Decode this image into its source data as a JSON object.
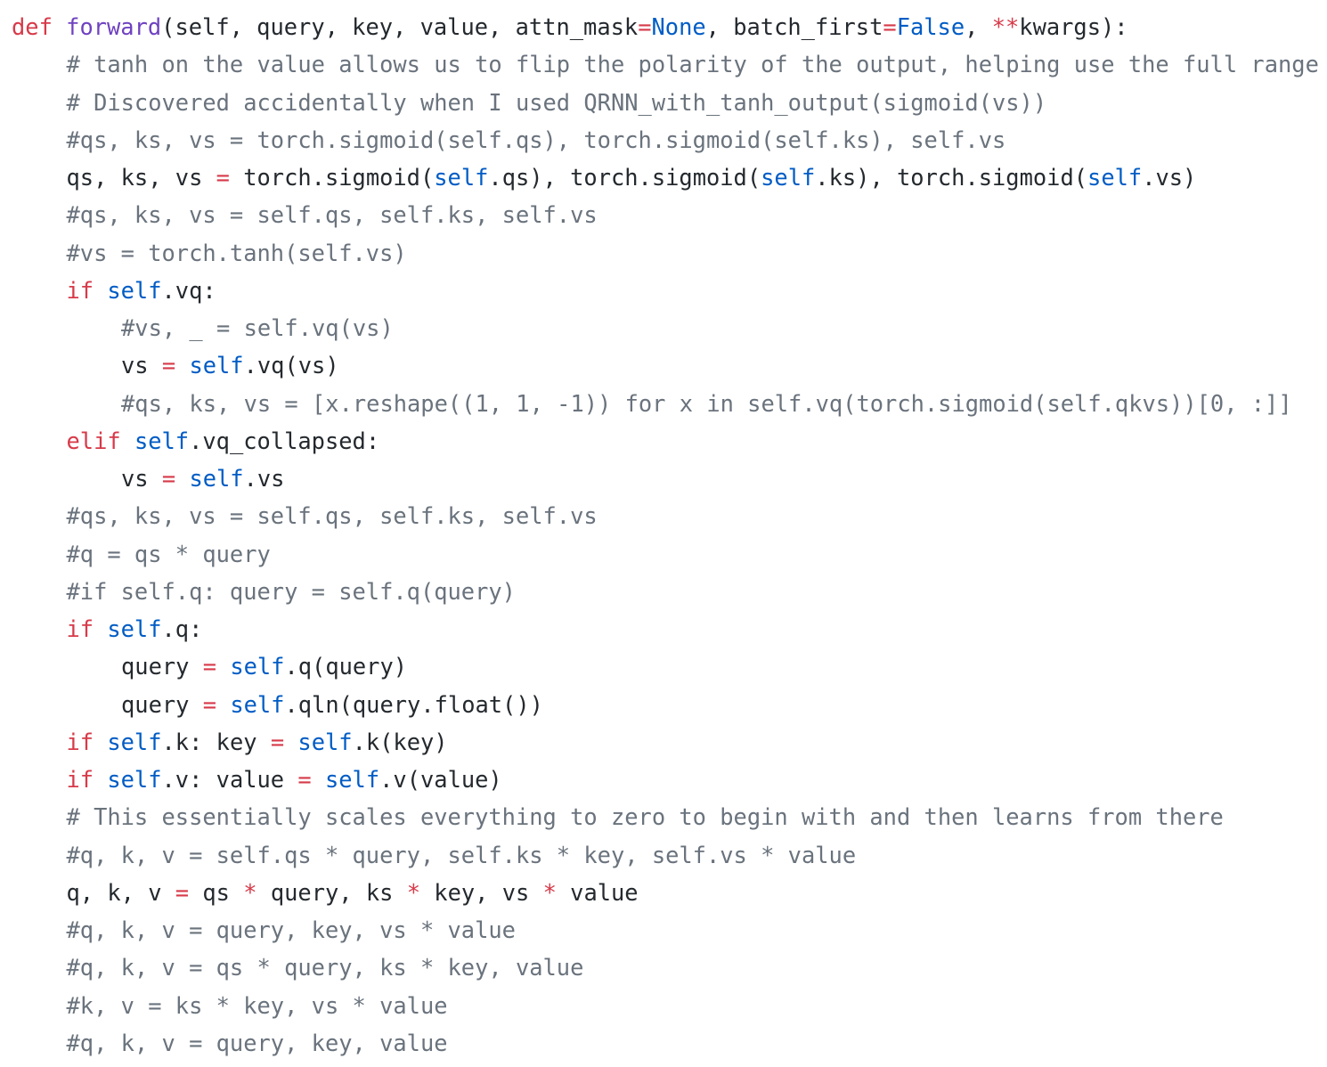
{
  "lines": [
    {
      "indent": 0,
      "tokens": [
        {
          "t": "kw",
          "v": "def "
        },
        {
          "t": "fn",
          "v": "forward"
        },
        {
          "t": "id",
          "v": "(self, query, key, value, attn_mask"
        },
        {
          "t": "op",
          "v": "="
        },
        {
          "t": "const",
          "v": "None"
        },
        {
          "t": "id",
          "v": ", batch_first"
        },
        {
          "t": "op",
          "v": "="
        },
        {
          "t": "const",
          "v": "False"
        },
        {
          "t": "id",
          "v": ", "
        },
        {
          "t": "op",
          "v": "**"
        },
        {
          "t": "id",
          "v": "kwargs):"
        }
      ]
    },
    {
      "indent": 1,
      "tokens": [
        {
          "t": "cm",
          "v": "# tanh on the value allows us to flip the polarity of the output, helping use the full range"
        }
      ]
    },
    {
      "indent": 1,
      "tokens": [
        {
          "t": "cm",
          "v": "# Discovered accidentally when I used QRNN_with_tanh_output(sigmoid(vs))"
        }
      ]
    },
    {
      "indent": 1,
      "tokens": [
        {
          "t": "cm",
          "v": "#qs, ks, vs = torch.sigmoid(self.qs), torch.sigmoid(self.ks), self.vs"
        }
      ]
    },
    {
      "indent": 1,
      "tokens": [
        {
          "t": "id",
          "v": "qs, ks, vs "
        },
        {
          "t": "op",
          "v": "="
        },
        {
          "t": "id",
          "v": " torch.sigmoid("
        },
        {
          "t": "const",
          "v": "self"
        },
        {
          "t": "id",
          "v": ".qs), torch.sigmoid("
        },
        {
          "t": "const",
          "v": "self"
        },
        {
          "t": "id",
          "v": ".ks), torch.sigmoid("
        },
        {
          "t": "const",
          "v": "self"
        },
        {
          "t": "id",
          "v": ".vs)"
        }
      ]
    },
    {
      "indent": 1,
      "tokens": [
        {
          "t": "cm",
          "v": "#qs, ks, vs = self.qs, self.ks, self.vs"
        }
      ]
    },
    {
      "indent": 1,
      "tokens": [
        {
          "t": "cm",
          "v": "#vs = torch.tanh(self.vs)"
        }
      ]
    },
    {
      "indent": 1,
      "tokens": [
        {
          "t": "kw",
          "v": "if "
        },
        {
          "t": "const",
          "v": "self"
        },
        {
          "t": "id",
          "v": ".vq:"
        }
      ]
    },
    {
      "indent": 2,
      "tokens": [
        {
          "t": "cm",
          "v": "#vs, _ = self.vq(vs)"
        }
      ]
    },
    {
      "indent": 2,
      "tokens": [
        {
          "t": "id",
          "v": "vs "
        },
        {
          "t": "op",
          "v": "="
        },
        {
          "t": "id",
          "v": " "
        },
        {
          "t": "const",
          "v": "self"
        },
        {
          "t": "id",
          "v": ".vq(vs)"
        }
      ]
    },
    {
      "indent": 2,
      "tokens": [
        {
          "t": "cm",
          "v": "#qs, ks, vs = [x.reshape((1, 1, -1)) for x in self.vq(torch.sigmoid(self.qkvs))[0, :]]"
        }
      ]
    },
    {
      "indent": 1,
      "tokens": [
        {
          "t": "kw",
          "v": "elif "
        },
        {
          "t": "const",
          "v": "self"
        },
        {
          "t": "id",
          "v": ".vq_collapsed:"
        }
      ]
    },
    {
      "indent": 2,
      "tokens": [
        {
          "t": "id",
          "v": "vs "
        },
        {
          "t": "op",
          "v": "="
        },
        {
          "t": "id",
          "v": " "
        },
        {
          "t": "const",
          "v": "self"
        },
        {
          "t": "id",
          "v": ".vs"
        }
      ]
    },
    {
      "indent": 1,
      "tokens": [
        {
          "t": "cm",
          "v": "#qs, ks, vs = self.qs, self.ks, self.vs"
        }
      ]
    },
    {
      "indent": 1,
      "tokens": [
        {
          "t": "cm",
          "v": "#q = qs * query"
        }
      ]
    },
    {
      "indent": 1,
      "tokens": [
        {
          "t": "cm",
          "v": "#if self.q: query = self.q(query)"
        }
      ]
    },
    {
      "indent": 1,
      "tokens": [
        {
          "t": "kw",
          "v": "if "
        },
        {
          "t": "const",
          "v": "self"
        },
        {
          "t": "id",
          "v": ".q:"
        }
      ]
    },
    {
      "indent": 2,
      "tokens": [
        {
          "t": "id",
          "v": "query "
        },
        {
          "t": "op",
          "v": "="
        },
        {
          "t": "id",
          "v": " "
        },
        {
          "t": "const",
          "v": "self"
        },
        {
          "t": "id",
          "v": ".q(query)"
        }
      ]
    },
    {
      "indent": 2,
      "tokens": [
        {
          "t": "id",
          "v": "query "
        },
        {
          "t": "op",
          "v": "="
        },
        {
          "t": "id",
          "v": " "
        },
        {
          "t": "const",
          "v": "self"
        },
        {
          "t": "id",
          "v": ".qln(query.float())"
        }
      ]
    },
    {
      "indent": 1,
      "tokens": [
        {
          "t": "kw",
          "v": "if "
        },
        {
          "t": "const",
          "v": "self"
        },
        {
          "t": "id",
          "v": ".k: key "
        },
        {
          "t": "op",
          "v": "="
        },
        {
          "t": "id",
          "v": " "
        },
        {
          "t": "const",
          "v": "self"
        },
        {
          "t": "id",
          "v": ".k(key)"
        }
      ]
    },
    {
      "indent": 1,
      "tokens": [
        {
          "t": "kw",
          "v": "if "
        },
        {
          "t": "const",
          "v": "self"
        },
        {
          "t": "id",
          "v": ".v: value "
        },
        {
          "t": "op",
          "v": "="
        },
        {
          "t": "id",
          "v": " "
        },
        {
          "t": "const",
          "v": "self"
        },
        {
          "t": "id",
          "v": ".v(value)"
        }
      ]
    },
    {
      "indent": 1,
      "tokens": [
        {
          "t": "cm",
          "v": "# This essentially scales everything to zero to begin with and then learns from there"
        }
      ]
    },
    {
      "indent": 1,
      "tokens": [
        {
          "t": "cm",
          "v": "#q, k, v = self.qs * query, self.ks * key, self.vs * value"
        }
      ]
    },
    {
      "indent": 1,
      "tokens": [
        {
          "t": "id",
          "v": "q, k, v "
        },
        {
          "t": "op",
          "v": "="
        },
        {
          "t": "id",
          "v": " qs "
        },
        {
          "t": "op",
          "v": "*"
        },
        {
          "t": "id",
          "v": " query, ks "
        },
        {
          "t": "op",
          "v": "*"
        },
        {
          "t": "id",
          "v": " key, vs "
        },
        {
          "t": "op",
          "v": "*"
        },
        {
          "t": "id",
          "v": " value"
        }
      ]
    },
    {
      "indent": 1,
      "tokens": [
        {
          "t": "cm",
          "v": "#q, k, v = query, key, vs * value"
        }
      ]
    },
    {
      "indent": 1,
      "tokens": [
        {
          "t": "cm",
          "v": "#q, k, v = qs * query, ks * key, value"
        }
      ]
    },
    {
      "indent": 1,
      "tokens": [
        {
          "t": "cm",
          "v": "#k, v = ks * key, vs * value"
        }
      ]
    },
    {
      "indent": 1,
      "tokens": [
        {
          "t": "cm",
          "v": "#q, k, v = query, key, value"
        }
      ]
    }
  ]
}
